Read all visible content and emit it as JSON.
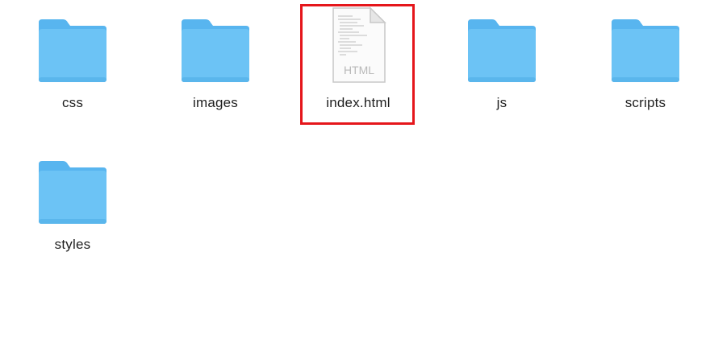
{
  "items": [
    {
      "label": "css",
      "type": "folder",
      "icon": "folder-icon"
    },
    {
      "label": "images",
      "type": "folder",
      "icon": "folder-icon"
    },
    {
      "label": "index.html",
      "type": "file",
      "icon": "html-file-icon",
      "badge": "HTML"
    },
    {
      "label": "js",
      "type": "folder",
      "icon": "folder-icon"
    },
    {
      "label": "scripts",
      "type": "folder",
      "icon": "folder-icon"
    },
    {
      "label": "styles",
      "type": "folder",
      "icon": "folder-icon"
    }
  ],
  "colors": {
    "folder_body": "#6cc3f5",
    "folder_tab": "#58b5ef",
    "highlight_border": "#e5161b",
    "label_text": "#1e1e1e"
  }
}
